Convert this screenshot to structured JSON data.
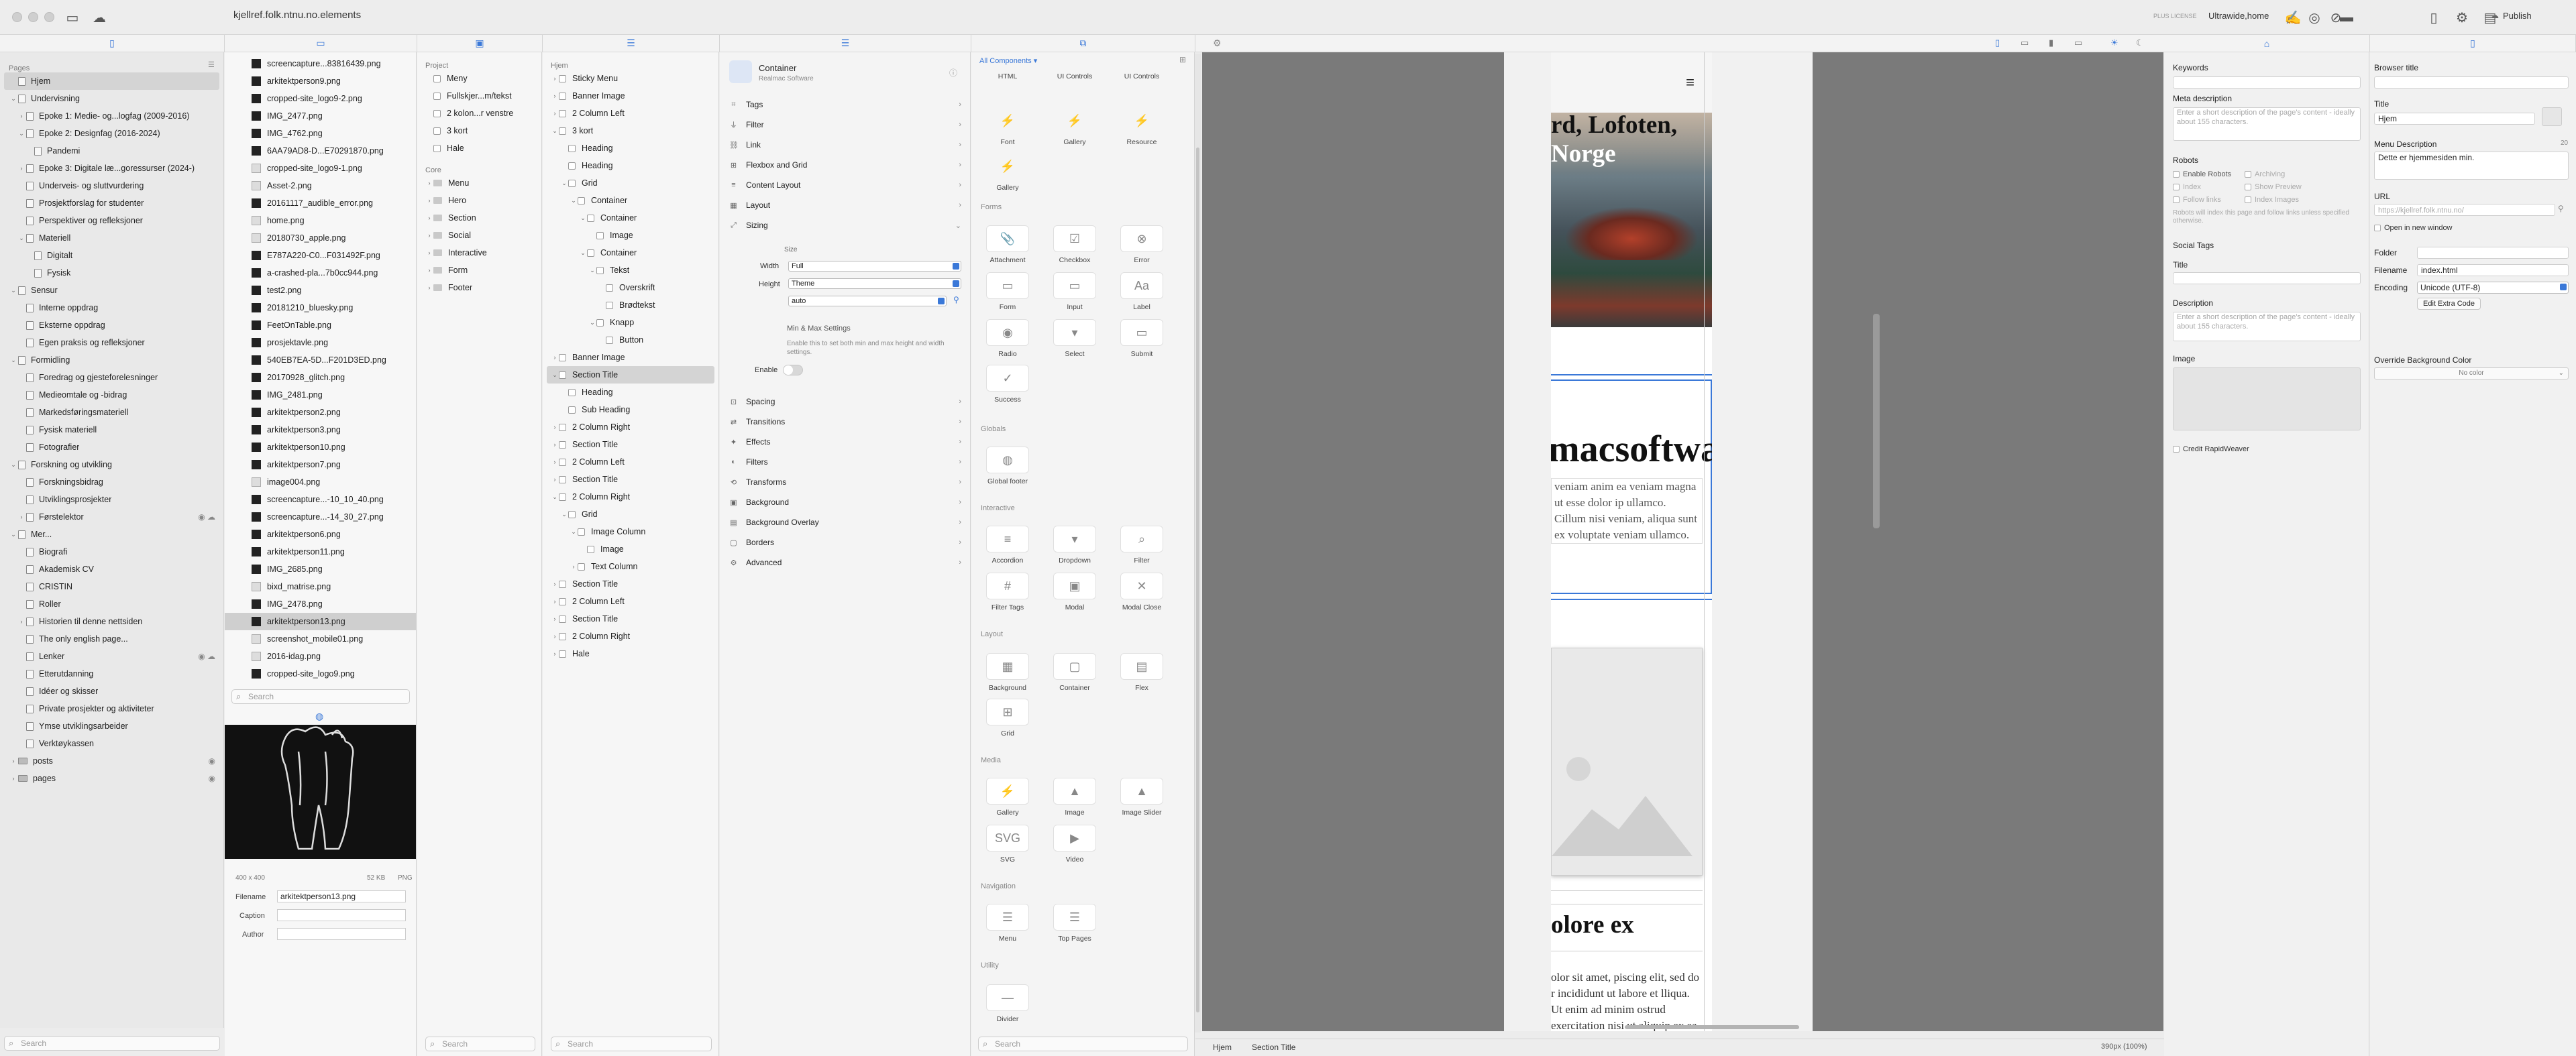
{
  "app": {
    "site_title": "kjellref.folk.ntnu.no.elements",
    "license": "PLUS LICENSE",
    "device": "Ultrawide,home",
    "publish": "Publish"
  },
  "pages": {
    "heading": "Pages",
    "search_placeholder": "Search",
    "items": [
      {
        "label": "Hjem",
        "depth": 0,
        "chev": "",
        "selected": true
      },
      {
        "label": "Undervisning",
        "depth": 0,
        "chev": "v"
      },
      {
        "label": "Epoke 1: Medie- og...logfag (2009-2016)",
        "depth": 1,
        "chev": ">"
      },
      {
        "label": "Epoke 2: Designfag (2016-2024)",
        "depth": 1,
        "chev": "v"
      },
      {
        "label": "Pandemi",
        "depth": 2,
        "chev": ""
      },
      {
        "label": "Epoke 3: Digitale læ...goressurser (2024-)",
        "depth": 1,
        "chev": ">"
      },
      {
        "label": "Underveis- og sluttvurdering",
        "depth": 1,
        "chev": ""
      },
      {
        "label": "Prosjektforslag for studenter",
        "depth": 1,
        "chev": ""
      },
      {
        "label": "Perspektiver og refleksjoner",
        "depth": 1,
        "chev": ""
      },
      {
        "label": "Materiell",
        "depth": 1,
        "chev": "v"
      },
      {
        "label": "Digitalt",
        "depth": 2,
        "chev": ""
      },
      {
        "label": "Fysisk",
        "depth": 2,
        "chev": ""
      },
      {
        "label": "Sensur",
        "depth": 0,
        "chev": "v"
      },
      {
        "label": "Interne oppdrag",
        "depth": 1,
        "chev": ""
      },
      {
        "label": "Eksterne oppdrag",
        "depth": 1,
        "chev": ""
      },
      {
        "label": "Egen praksis og refleksjoner",
        "depth": 1,
        "chev": ""
      },
      {
        "label": "Formidling",
        "depth": 0,
        "chev": "v"
      },
      {
        "label": "Foredrag og gjesteforelesninger",
        "depth": 1,
        "chev": ""
      },
      {
        "label": "Medieomtale og -bidrag",
        "depth": 1,
        "chev": ""
      },
      {
        "label": "Markedsføringsmateriell",
        "depth": 1,
        "chev": ""
      },
      {
        "label": "Fysisk materiell",
        "depth": 1,
        "chev": ""
      },
      {
        "label": "Fotografier",
        "depth": 1,
        "chev": ""
      },
      {
        "label": "Forskning og utvikling",
        "depth": 0,
        "chev": "v"
      },
      {
        "label": "Forskningsbidrag",
        "depth": 1,
        "chev": ""
      },
      {
        "label": "Utviklingsprosjekter",
        "depth": 1,
        "chev": ""
      },
      {
        "label": "Førstelektor",
        "depth": 1,
        "chev": ">",
        "tail": "◉ ☁"
      },
      {
        "label": "Mer...",
        "depth": 0,
        "chev": "v"
      },
      {
        "label": "Biografi",
        "depth": 1,
        "chev": ""
      },
      {
        "label": "Akademisk CV",
        "depth": 1,
        "chev": ""
      },
      {
        "label": "CRISTIN",
        "depth": 1,
        "chev": ""
      },
      {
        "label": "Roller",
        "depth": 1,
        "chev": ""
      },
      {
        "label": "Historien til denne nettsiden",
        "depth": 1,
        "chev": ">"
      },
      {
        "label": "The only english page...",
        "depth": 1,
        "chev": ""
      },
      {
        "label": "Lenker",
        "depth": 1,
        "chev": "",
        "tail": "◉ ☁"
      },
      {
        "label": "Etterutdanning",
        "depth": 1,
        "chev": ""
      },
      {
        "label": "Idéer og skisser",
        "depth": 1,
        "chev": ""
      },
      {
        "label": "Private prosjekter og aktiviteter",
        "depth": 1,
        "chev": ""
      },
      {
        "label": "Ymse utviklingsarbeider",
        "depth": 1,
        "chev": ""
      },
      {
        "label": "Verktøykassen",
        "depth": 1,
        "chev": ""
      },
      {
        "label": "posts",
        "depth": 0,
        "chev": ">",
        "tail": "◉",
        "folder": true
      },
      {
        "label": "pages",
        "depth": 0,
        "chev": ">",
        "tail": "◉",
        "folder": true
      }
    ]
  },
  "files": {
    "search_placeholder": "Search",
    "items": [
      "screencapture...83816439.png",
      "arkitektperson9.png",
      "cropped-site_logo9-2.png",
      "IMG_2477.png",
      "IMG_4762.png",
      "6AA79AD8-D...E70291870.png",
      "cropped-site_logo9-1.png",
      "Asset-2.png",
      "20161117_audible_error.png",
      "home.png",
      "20180730_apple.png",
      "E787A220-C0...F031492F.png",
      "a-crashed-pla...7b0cc944.png",
      "test2.png",
      "20181210_bluesky.png",
      "FeetOnTable.png",
      "prosjektavle.png",
      "540EB7EA-5D...F201D3ED.png",
      "20170928_glitch.png",
      "IMG_2481.png",
      "arkitektperson2.png",
      "arkitektperson3.png",
      "arkitektperson10.png",
      "arkitektperson7.png",
      "image004.png",
      "screencapture...-10_10_40.png",
      "screencapture...-14_30_27.png",
      "arkitektperson6.png",
      "arkitektperson11.png",
      "IMG_2685.png",
      "bixd_matrise.png",
      "IMG_2478.png",
      "arkitektperson13.png",
      "screenshot_mobile01.png",
      "2016-idag.png",
      "cropped-site_logo9.png"
    ],
    "selected_index": 32,
    "preview": {
      "dims": "400 x 400",
      "size": "52 KB",
      "type": "PNG"
    },
    "fields": {
      "filename_label": "Filename",
      "filename_value": "arkitektperson13.png",
      "caption_label": "Caption",
      "author_label": "Author"
    }
  },
  "project": {
    "group1": "Project",
    "items1": [
      "Meny",
      "Fullskjer...m/tekst",
      "2 kolon...r venstre",
      "3 kort",
      "Hale"
    ],
    "group2": "Core",
    "items2": [
      "Menu",
      "Hero",
      "Section",
      "Social",
      "Interactive",
      "Form",
      "Footer"
    ],
    "search_placeholder": "Search"
  },
  "outline": {
    "root": "Hjem",
    "search_placeholder": "Search",
    "items": [
      {
        "label": "Sticky Menu",
        "depth": 0,
        "chev": ">"
      },
      {
        "label": "Banner Image",
        "depth": 0,
        "chev": ">"
      },
      {
        "label": "2 Column Left",
        "depth": 0,
        "chev": ">"
      },
      {
        "label": "3 kort",
        "depth": 0,
        "chev": "v"
      },
      {
        "label": "Heading",
        "depth": 1,
        "chev": ""
      },
      {
        "label": "Heading",
        "depth": 1,
        "chev": ""
      },
      {
        "label": "Grid",
        "depth": 1,
        "chev": "v"
      },
      {
        "label": "Container",
        "depth": 2,
        "chev": "v"
      },
      {
        "label": "Container",
        "depth": 3,
        "chev": "v"
      },
      {
        "label": "Image",
        "depth": 4,
        "chev": ""
      },
      {
        "label": "Container",
        "depth": 3,
        "chev": "v"
      },
      {
        "label": "Tekst",
        "depth": 4,
        "chev": "v"
      },
      {
        "label": "Overskrift",
        "depth": 5,
        "chev": ""
      },
      {
        "label": "Brødtekst",
        "depth": 5,
        "chev": ""
      },
      {
        "label": "Knapp",
        "depth": 4,
        "chev": "v"
      },
      {
        "label": "Button",
        "depth": 5,
        "chev": ""
      },
      {
        "label": "Banner Image",
        "depth": 0,
        "chev": ">"
      },
      {
        "label": "Section Title",
        "depth": 0,
        "chev": "v",
        "selected": true
      },
      {
        "label": "Heading",
        "depth": 1,
        "chev": ""
      },
      {
        "label": "Sub Heading",
        "depth": 1,
        "chev": ""
      },
      {
        "label": "2 Column Right",
        "depth": 0,
        "chev": ">"
      },
      {
        "label": "Section Title",
        "depth": 0,
        "chev": ">"
      },
      {
        "label": "2 Column Left",
        "depth": 0,
        "chev": ">"
      },
      {
        "label": "Section Title",
        "depth": 0,
        "chev": ">"
      },
      {
        "label": "2 Column Right",
        "depth": 0,
        "chev": "v"
      },
      {
        "label": "Grid",
        "depth": 1,
        "chev": "v"
      },
      {
        "label": "Image Column",
        "depth": 2,
        "chev": "v"
      },
      {
        "label": "Image",
        "depth": 3,
        "chev": ""
      },
      {
        "label": "Text Column",
        "depth": 2,
        "chev": ">"
      },
      {
        "label": "Section Title",
        "depth": 0,
        "chev": ">"
      },
      {
        "label": "2 Column Left",
        "depth": 0,
        "chev": ">"
      },
      {
        "label": "Section Title",
        "depth": 0,
        "chev": ">"
      },
      {
        "label": "2 Column Right",
        "depth": 0,
        "chev": ">"
      },
      {
        "label": "Hale",
        "depth": 0,
        "chev": ">"
      }
    ]
  },
  "inspector": {
    "component": "Container",
    "vendor": "Realmac Software",
    "sections_top": [
      "Tags",
      "Filter",
      "Link",
      "Flexbox and Grid",
      "Content Layout",
      "Layout",
      "Sizing"
    ],
    "size_label": "Size",
    "width_label": "Width",
    "width_value": "Full",
    "height_label": "Height",
    "height_value": "Theme",
    "auto_value": "auto",
    "minmax_title": "Min & Max Settings",
    "minmax_desc": "Enable this to set both min and max height and width settings.",
    "enable_label": "Enable",
    "sections_bottom": [
      "Spacing",
      "Transitions",
      "Effects",
      "Filters",
      "Transforms",
      "Background",
      "Background Overlay",
      "Borders",
      "Advanced"
    ]
  },
  "components": {
    "filter": "All Components",
    "search_placeholder": "Search",
    "groups": {
      "globals": "Globals",
      "interactive": "Interactive",
      "layout": "Layout",
      "media": "Media",
      "navigation": "Navigation",
      "utility": "Utility",
      "forms": "Forms"
    },
    "items": {
      "top": [
        "HTML",
        "UI Controls",
        "UI Controls"
      ],
      "r1": [
        "Font",
        "Gallery",
        "Resource"
      ],
      "r2": [
        "Gallery"
      ],
      "forms1": [
        "Attachment",
        "Checkbox",
        "Error"
      ],
      "forms2": [
        "Form",
        "Input",
        "Label"
      ],
      "forms3": [
        "Radio",
        "Select",
        "Submit"
      ],
      "forms4": [
        "Success"
      ],
      "globals": [
        "Global footer"
      ],
      "inter1": [
        "Accordion",
        "Dropdown",
        "Filter"
      ],
      "inter2": [
        "Filter Tags",
        "Modal",
        "Modal Close"
      ],
      "layout1": [
        "Background",
        "Container",
        "Flex"
      ],
      "layout2": [
        "Grid"
      ],
      "media1": [
        "Gallery",
        "Image",
        "Image Slider"
      ],
      "media2": [
        "SVG",
        "Video"
      ],
      "nav": [
        "Menu",
        "Top Pages"
      ],
      "util": [
        "Divider"
      ]
    }
  },
  "canvas": {
    "hero_text_1": "rd, Lofoten,",
    "hero_text_2": "Norge",
    "brand": "macsoftware",
    "body": "veniam anim ea veniam magna ut esse dolor ip ullamco. Cillum nisi veniam, aliqua sunt ex voluptate veniam ullamco.",
    "heading2": "olore ex",
    "lorem": "olor sit amet, piscing elit, sed do r incididunt ut labore et lliqua. Ut enim ad minim ostrud exercitation nisi ut aliquip ex ea"
  },
  "status": {
    "crumb1": "Hjem",
    "crumb2": "Section Title",
    "zoom": "390px (100%)"
  },
  "seo": {
    "keywords": "Keywords",
    "meta_description": "Meta description",
    "meta_placeholder": "Enter a short description of the page's content - ideally about 155 characters.",
    "robots": "Robots",
    "checks": [
      {
        "label": "Enable Robots",
        "dis": false
      },
      {
        "label": "Archiving",
        "dis": true
      },
      {
        "label": "Index",
        "dis": true
      },
      {
        "label": "Show Preview",
        "dis": true
      },
      {
        "label": "Follow links",
        "dis": true
      },
      {
        "label": "Index Images",
        "dis": true
      }
    ],
    "robots_note": "Robots will index this page and follow links unless specified otherwise.",
    "social_tags": "Social Tags",
    "title": "Title",
    "description": "Description",
    "desc_placeholder": "Enter a short description of the page's content - ideally about 155 characters.",
    "image": "Image",
    "credit": "Credit RapidWeaver"
  },
  "page_settings": {
    "browser_title": "Browser title",
    "title_label": "Title",
    "title_value": "Hjem",
    "menu_desc_label": "Menu Description",
    "menu_desc_count": "20",
    "menu_desc_value": "Dette er hjemmesiden min.",
    "url_label": "URL",
    "url_placeholder": "https://kjellref.folk.ntnu.no/",
    "open_new": "Open in new window",
    "folder_label": "Folder",
    "filename_label": "Filename",
    "filename_value": "index.html",
    "encoding_label": "Encoding",
    "encoding_value": "Unicode (UTF-8)",
    "extra_code": "Edit Extra Code",
    "bg_label": "Override Background Color",
    "bg_value": "No color"
  }
}
